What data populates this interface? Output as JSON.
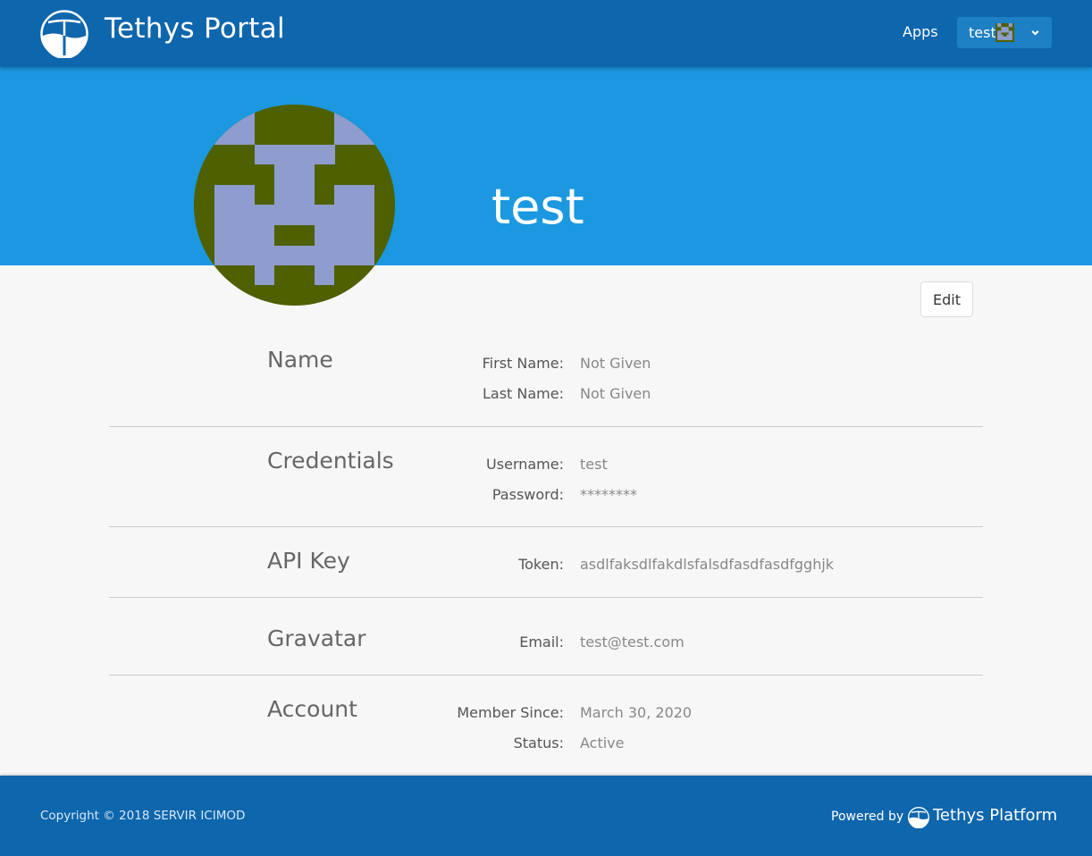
{
  "header": {
    "brand_title": "Tethys Portal",
    "apps_link": "Apps",
    "user_menu_name": "test",
    "nav_color": "#0e66ad"
  },
  "banner": {
    "username": "test",
    "color": "#1b98e0"
  },
  "avatar": {
    "bg_color": "#4f6000",
    "fg_color": "#8e9dcd"
  },
  "actions": {
    "edit_label": "Edit"
  },
  "sections": {
    "name": {
      "title": "Name",
      "first_name_label": "First Name:",
      "first_name_value": "Not Given",
      "last_name_label": "Last Name:",
      "last_name_value": "Not Given"
    },
    "credentials": {
      "title": "Credentials",
      "username_label": "Username:",
      "username_value": "test",
      "password_label": "Password:",
      "password_value": "********"
    },
    "api_key": {
      "title": "API Key",
      "token_label": "Token:",
      "token_value": "asdlfaksdlfakdlsfalsdfasdfasdfgghjk"
    },
    "gravatar": {
      "title": "Gravatar",
      "email_label": "Email:",
      "email_value": "test@test.com"
    },
    "account": {
      "title": "Account",
      "member_since_label": "Member Since:",
      "member_since_value": "March 30, 2020",
      "status_label": "Status:",
      "status_value": "Active"
    }
  },
  "footer": {
    "copyright": "Copyright © 2018 SERVIR ICIMOD",
    "powered_by": "Powered by",
    "platform_name": "Tethys Platform"
  },
  "icons": {
    "brand_logo": "tethys-logo-icon",
    "user_chevron": "chevron-down-icon",
    "footer_logo": "tethys-logo-icon"
  }
}
